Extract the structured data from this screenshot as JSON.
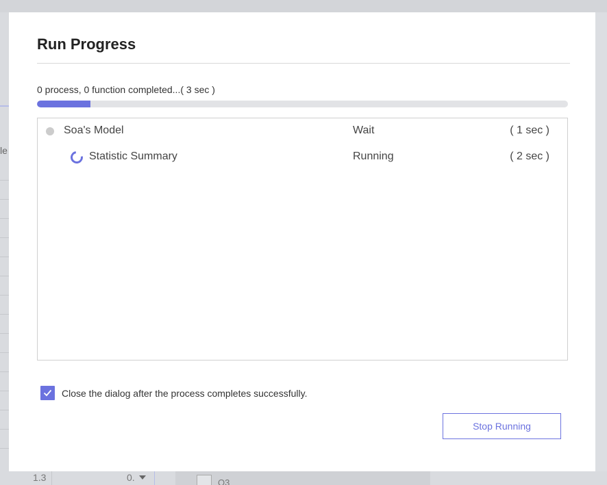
{
  "background": {
    "left_partial_label": "le",
    "bottom_cells": [
      "1.3",
      "0."
    ],
    "bottom_checkbox_label": "Q3"
  },
  "dialog": {
    "title": "Run Progress",
    "status": "0 process, 0 function completed...( 3 sec )",
    "progress_fraction": 0.1,
    "tasks": [
      {
        "name": "Soa's Model",
        "state": "Wait",
        "time": "( 1 sec )",
        "icon": "pending-dot-icon"
      },
      {
        "name": "Statistic Summary",
        "state": "Running",
        "time": "( 2 sec )",
        "icon": "loading-spinner-icon"
      }
    ],
    "close_after_success": {
      "checked": true,
      "label": "Close the dialog after the process completes successfully."
    },
    "stop_button_label": "Stop Running"
  },
  "colors": {
    "accent": "#6b72df",
    "track": "#e2e3e6",
    "pending": "#cccccc"
  }
}
